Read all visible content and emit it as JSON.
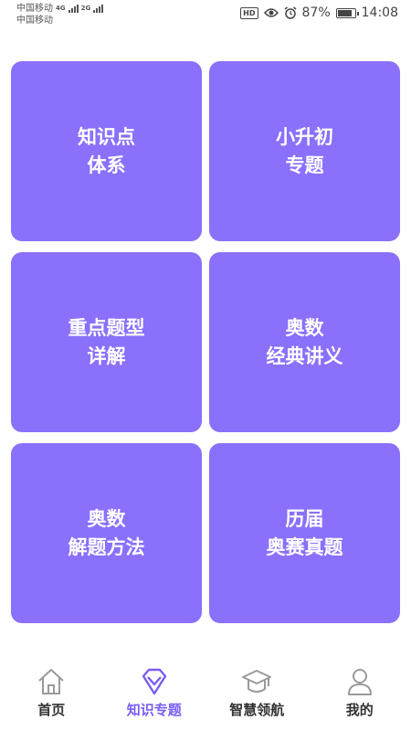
{
  "status_bar": {
    "carrier_1": "中国移动",
    "net_1": "4G",
    "carrier_2": "中国移动",
    "net_2": "2G",
    "hd": "HD",
    "battery": "87%",
    "battery_level": 0.87,
    "time": "14:08",
    "icons": [
      "hd-icon",
      "eye-icon",
      "alarm-icon",
      "battery-icon"
    ]
  },
  "tiles": [
    {
      "line1": "知识点",
      "line2": "体系"
    },
    {
      "line1": "小升初",
      "line2": "专题"
    },
    {
      "line1": "重点题型",
      "line2": "详解"
    },
    {
      "line1": "奥数",
      "line2": "经典讲义"
    },
    {
      "line1": "奥数",
      "line2": "解题方法"
    },
    {
      "line1": "历届",
      "line2": "奥赛真题"
    }
  ],
  "tabbar": {
    "tabs": [
      {
        "label": "首页",
        "icon": "home-icon"
      },
      {
        "label": "知识专题",
        "icon": "diamond-icon",
        "active": true
      },
      {
        "label": "智慧领航",
        "icon": "graduation-cap-icon"
      },
      {
        "label": "我的",
        "icon": "user-icon"
      }
    ]
  },
  "colors": {
    "tile": "#8b70fb",
    "active_tab": "#7b5cf5",
    "inactive_icon": "#9a9a9a"
  }
}
